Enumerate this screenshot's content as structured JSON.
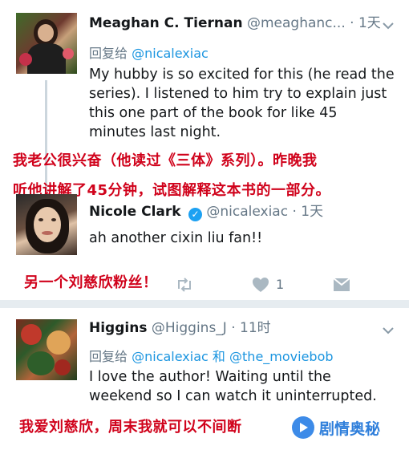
{
  "tweets": [
    {
      "name": "Meaghan C. Tiernan",
      "handle": "@meaghanc...",
      "dot": "·",
      "time": "1天",
      "replying_prefix": "回复给",
      "replying_to": "@nicalexiac",
      "text": "My hubby is so excited for this (he read the series). I listened to him try to explain just this one part of the book for like 45 minutes last night.",
      "translation_line1": "我老公很兴奋（他读过《三体》系列）。昨晚我",
      "translation_line2": "听他讲解了45分钟，试图解释这本书的一部分。"
    },
    {
      "name": "Nicole Clark",
      "handle": "@nicalexiac",
      "dot": "·",
      "time": "1天",
      "text": "ah another cixin liu fan!!",
      "translation": "另一个刘慈欣粉丝！",
      "like_count": "1"
    },
    {
      "name": "Higgins",
      "handle": "@Higgins_J",
      "dot": "·",
      "time": "11时",
      "replying_prefix": "回复给",
      "replying_to_1": "@nicalexiac",
      "replying_joiner": "和",
      "replying_to_2": "@the_moviebob",
      "text": "I love the author! Waiting until the weekend so I can watch it uninterrupted.",
      "translation": "我爱刘慈欣，周末我就可以不间断"
    }
  ],
  "watermark": {
    "text": "剧情奥秘"
  },
  "colors": {
    "link": "#1b95e0",
    "muted": "#657786",
    "overlay": "#d0021b",
    "divider": "#e6ecf0"
  },
  "icons": [
    "chevron-down-icon",
    "verified-badge-icon",
    "retweet-icon",
    "like-icon",
    "message-icon"
  ]
}
